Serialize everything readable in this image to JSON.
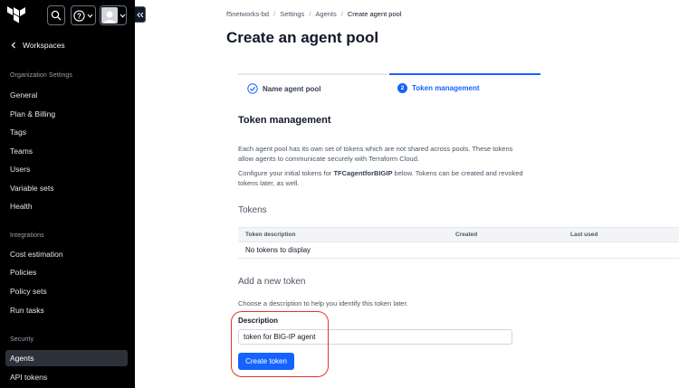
{
  "sidebar": {
    "back_label": "Workspaces",
    "sections": [
      {
        "title": "Organization Settings",
        "items": [
          "General",
          "Plan & Billing",
          "Tags",
          "Teams",
          "Users",
          "Variable sets",
          "Health"
        ]
      },
      {
        "title": "Integrations",
        "items": [
          "Cost estimation",
          "Policies",
          "Policy sets",
          "Run tasks"
        ]
      },
      {
        "title": "Security",
        "items": [
          "Agents",
          "API tokens"
        ]
      }
    ],
    "active_item": "Agents",
    "help_glyph": "?"
  },
  "breadcrumb": [
    "f5networks-bd",
    "Settings",
    "Agents",
    "Create agent pool"
  ],
  "page_title": "Create an agent pool",
  "steps": [
    {
      "label": "Name agent pool",
      "state": "complete"
    },
    {
      "label": "Token management",
      "state": "active",
      "number": "2"
    }
  ],
  "token_management": {
    "heading": "Token management",
    "description": "Each agent pool has its own set of tokens which are not shared across pools. These tokens allow agents to communicate securely with Terraform Cloud.",
    "config_prefix": "Configure your initial tokens for ",
    "pool_name": "TFCagentforBIGIP",
    "config_suffix": " below. Tokens can be created and revoked tokens later, as well."
  },
  "tokens": {
    "heading": "Tokens",
    "columns": [
      "Token description",
      "Created",
      "Last used"
    ],
    "empty_text": "No tokens to display"
  },
  "new_token": {
    "heading": "Add a new token",
    "hint": "Choose a description to help you identify this token later.",
    "field_label": "Description",
    "field_value": "token for BIG-IP agent",
    "button_label": "Create token"
  },
  "colors": {
    "accent": "#1563ff",
    "highlight": "#e0362b",
    "sidebar_bg": "#000000"
  }
}
